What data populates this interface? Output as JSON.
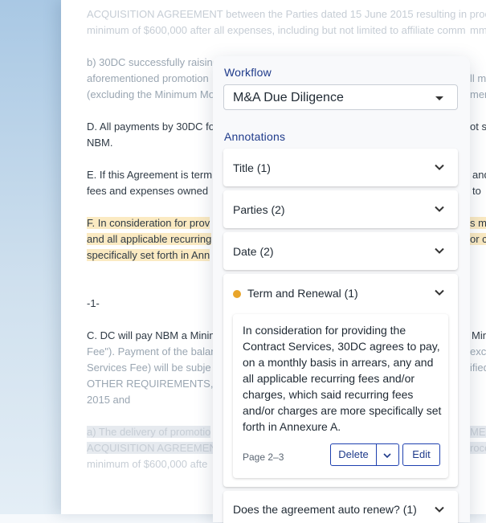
{
  "document": {
    "lines": [
      "ACQUISITION AGREEMENT between the Parties dated 15 June 2015 resulting in proce",
      "minimum of $600,000 after all expenses, including but not limited to affiliate comm",
      "b) 30DC successfully raising",
      "aforementioned promotion",
      "(excluding the Minimum Mo",
      "D. All payments by 30DC fo",
      "NBM.",
      "E. If this Agreement is term",
      "fees and expenses owned",
      "F. In consideration for prov",
      "and all applicable recurring",
      "specifically set forth in Ann",
      "-1-",
      "C. DC will pay NBM a Minim",
      "Fee\"). Payment of the balan",
      "Services Fee) will be subje",
      "OTHER REQUIREMENTS, par",
      "2015 and",
      "a) The delivery of promotio",
      "ACQUISITION AGREEMENT",
      "minimum of $600,000 afte"
    ],
    "right_fragments": [
      "ll m",
      "ment",
      "ot sh",
      "and",
      "to",
      "s mo",
      "or ch",
      "Min",
      "exclu",
      "ified",
      "MEN",
      "roce",
      "mm"
    ]
  },
  "panel": {
    "workflow_label": "Workflow",
    "workflow_value": "M&A Due Diligence",
    "annotations_label": "Annotations",
    "cards": [
      {
        "title": "Title (1)"
      },
      {
        "title": "Parties (2)"
      },
      {
        "title": "Date (2)"
      }
    ],
    "expanded_card": {
      "title": "Term and Renewal (1)",
      "dot_color": "#e9a52a",
      "excerpt": "In consideration for providing the Contract Services, 30DC agrees to pay, on a monthly basis in arrears, any and all applicable recurring fees and/or charges, which said recurring fees and/or charges are more specifically set forth in Annexure A.",
      "page": "Page 2–3",
      "delete_label": "Delete",
      "edit_label": "Edit"
    },
    "bottom_card": {
      "title": "Does the agreement auto renew? (1)"
    }
  },
  "colors": {
    "accent": "#1e3a8a",
    "highlight": "#fbeac2",
    "marker": "#e9a52a"
  }
}
